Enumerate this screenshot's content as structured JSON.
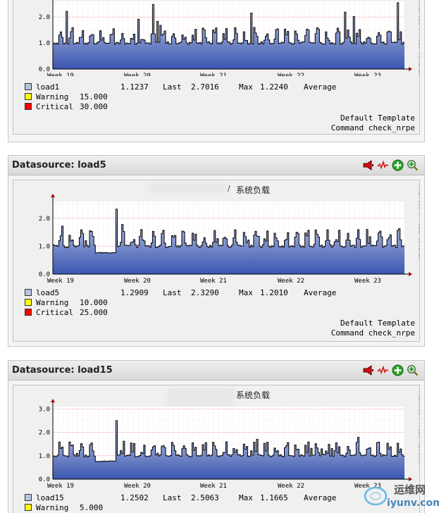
{
  "time_labels": [
    "Week 19",
    "Week 20",
    "Week 21",
    "Week 22",
    "Week 23"
  ],
  "panel_top": {
    "graph": {
      "y_ticks": [
        "0.0",
        "1.0",
        "2.0"
      ],
      "ymax": 2.6
    },
    "legend": {
      "series_name": "load1",
      "series_color": "#b7c3de",
      "last_label": "Last",
      "last_value": "1.1237",
      "max_label": "Max",
      "max_value": "2.7016",
      "avg_label": "Average",
      "avg_value": "1.2240",
      "warning_label": "Warning",
      "warning_value": "15.000",
      "warning_color": "#ffff00",
      "critical_label": "Critical",
      "critical_value": "30.000",
      "critical_color": "#ff0000"
    },
    "template_line": "Default Template",
    "command_line": "Command check_nrpe"
  },
  "panel_load5": {
    "title": "Datasource: load5",
    "graph": {
      "title": "系统负载",
      "title_prefix": "/",
      "y_ticks": [
        "0.0",
        "1.0",
        "2.0"
      ],
      "ymax": 2.6
    },
    "legend": {
      "series_name": "load5",
      "series_color": "#b7c3de",
      "last_label": "Last",
      "last_value": "1.2909",
      "max_label": "Max",
      "max_value": "2.3290",
      "avg_label": "Average",
      "avg_value": "1.2010",
      "warning_label": "Warning",
      "warning_value": "10.000",
      "warning_color": "#ffff00",
      "critical_label": "Critical",
      "critical_value": "25.000",
      "critical_color": "#ff0000"
    },
    "template_line": "Default Template",
    "command_line": "Command check_nrpe"
  },
  "panel_load15": {
    "title": "Datasource: load15",
    "graph": {
      "title": "系统负载",
      "y_ticks": [
        "0.0",
        "1.0",
        "2.0",
        "3.0"
      ],
      "ymax": 3.1
    },
    "legend": {
      "series_name": "load15",
      "series_color": "#b7c3de",
      "last_label": "Last",
      "last_value": "1.2502",
      "max_label": "Max",
      "max_value": "2.5063",
      "avg_label": "Average",
      "avg_value": "1.1665",
      "warning_label": "Warning",
      "warning_value": "5.000",
      "warning_color": "#ffff00"
    }
  },
  "side_text": "RRDTOOL / TOBI OETIKER",
  "watermark": {
    "brand": "运维网",
    "url": "iyunv.com"
  },
  "icons": [
    "megaphone-icon",
    "graph-line-icon",
    "plus-icon",
    "zoom-icon"
  ]
}
